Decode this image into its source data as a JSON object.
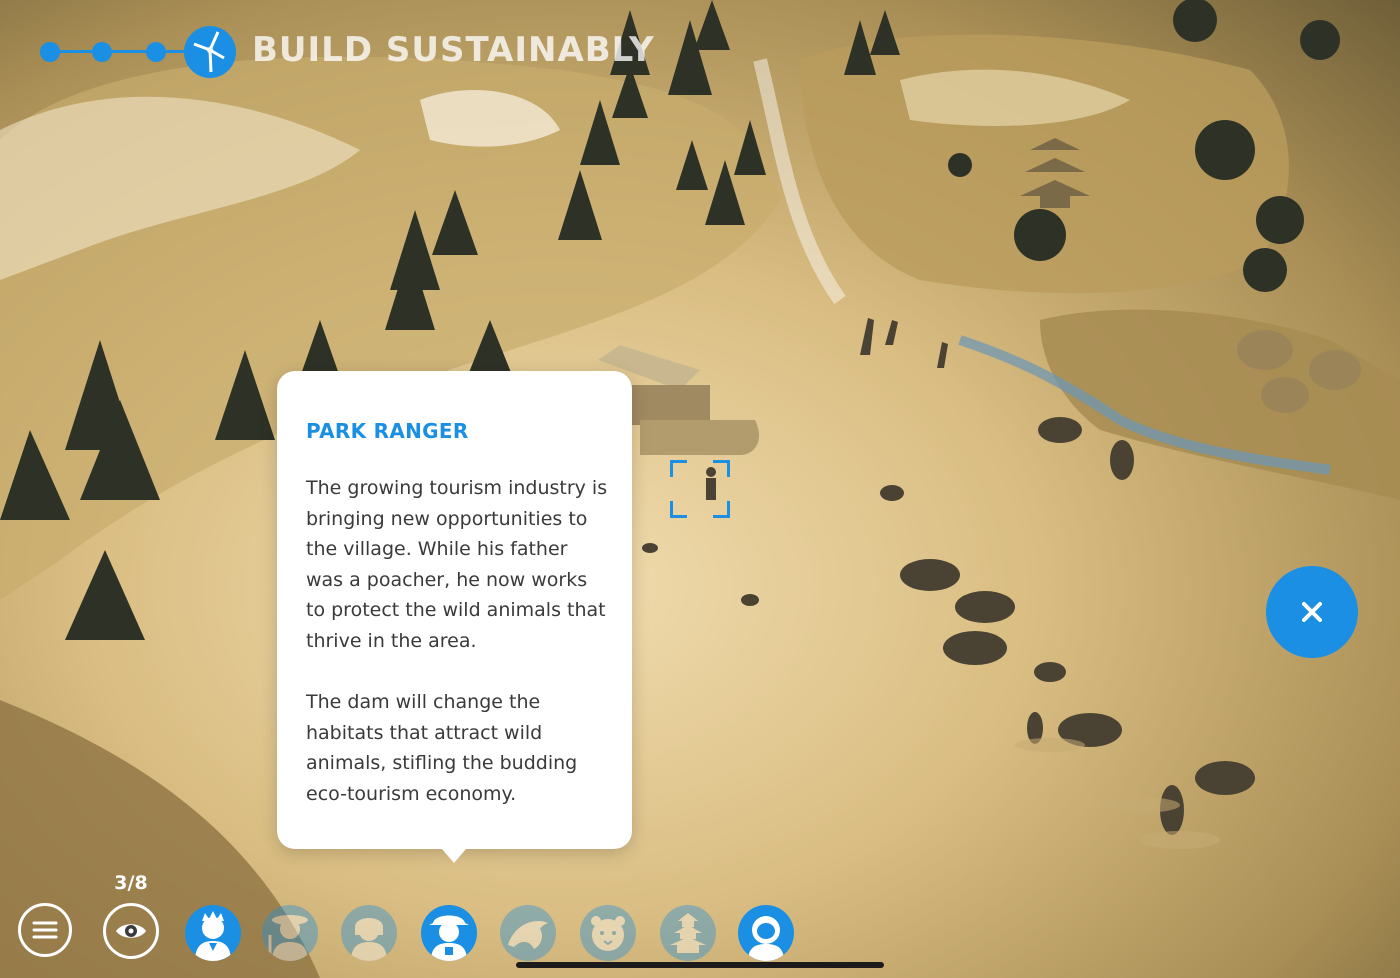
{
  "header": {
    "title": "BUILD SUSTAINABLY",
    "progress_icon": "wind-turbine-icon"
  },
  "info_card": {
    "title": "PARK RANGER",
    "paragraphs": [
      "The growing tourism industry is bringing new opportunities to the village. While his father was a poacher, he now works to protect the wild animals that thrive in the area.",
      "The dam will change the habitats that attract wild animals, stifling the budding eco-tourism economy."
    ]
  },
  "controls": {
    "close_icon": "close-icon",
    "menu_icon": "hamburger-menu-icon",
    "view_icon": "eye-icon",
    "view_counter": "3/8"
  },
  "characters": [
    {
      "icon": "leader-character-icon",
      "active": true
    },
    {
      "icon": "farmer-character-icon",
      "active": false
    },
    {
      "icon": "villager-character-icon",
      "active": false
    },
    {
      "icon": "park-ranger-character-icon",
      "active": true
    },
    {
      "icon": "dolphin-character-icon",
      "active": false
    },
    {
      "icon": "tiger-character-icon",
      "active": false
    },
    {
      "icon": "pagoda-character-icon",
      "active": false
    },
    {
      "icon": "astronaut-character-icon",
      "active": true
    }
  ],
  "colors": {
    "accent": "#1a8fe3",
    "card_background": "#ffffff",
    "card_text": "#3a3a3a",
    "terrain_light": "#f2ddb0",
    "terrain_dark": "#6f5f38",
    "tree": "#2e3226"
  }
}
